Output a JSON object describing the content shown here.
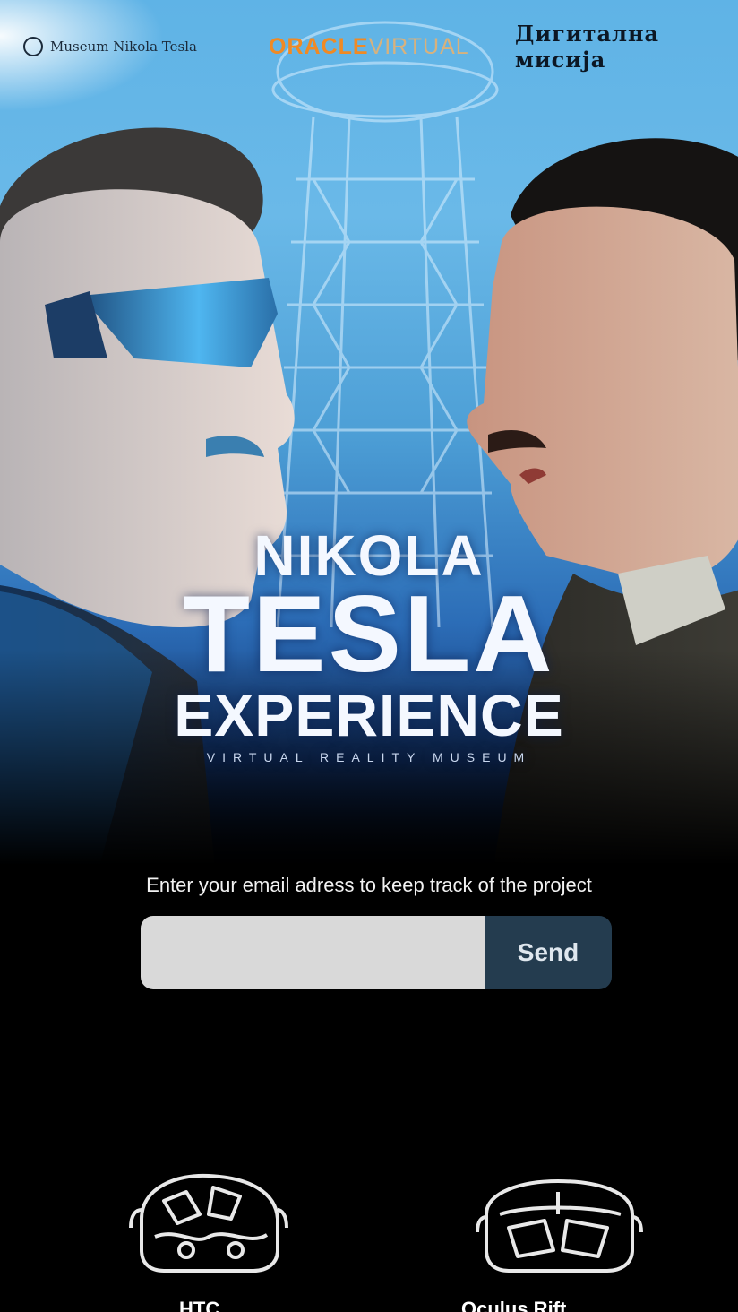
{
  "header": {
    "logo_left": "Museum Nikola Tesla",
    "logo_mid_part1": "ORACLE",
    "logo_mid_part2": "VIRTUAL",
    "logo_right": "Дигитална мисија"
  },
  "hero": {
    "title_line1": "NIKOLA",
    "title_line2": "TESLA",
    "title_line3": "EXPERIENCE",
    "subtitle": "VIRTUAL REALITY MUSEUM"
  },
  "signup": {
    "prompt": "Enter your email adress to keep track of the project",
    "email_placeholder": "",
    "send_label": "Send"
  },
  "devices": {
    "items": [
      {
        "icon": "vr-headset-icon",
        "label": "HTC Vive"
      },
      {
        "icon": "vr-headset-icon",
        "label": "Oculus Rift"
      }
    ]
  },
  "colors": {
    "accent_orange": "#f08a24",
    "send_button": "#243c4f",
    "input_bg": "#d9d9d9",
    "background": "#000000"
  }
}
